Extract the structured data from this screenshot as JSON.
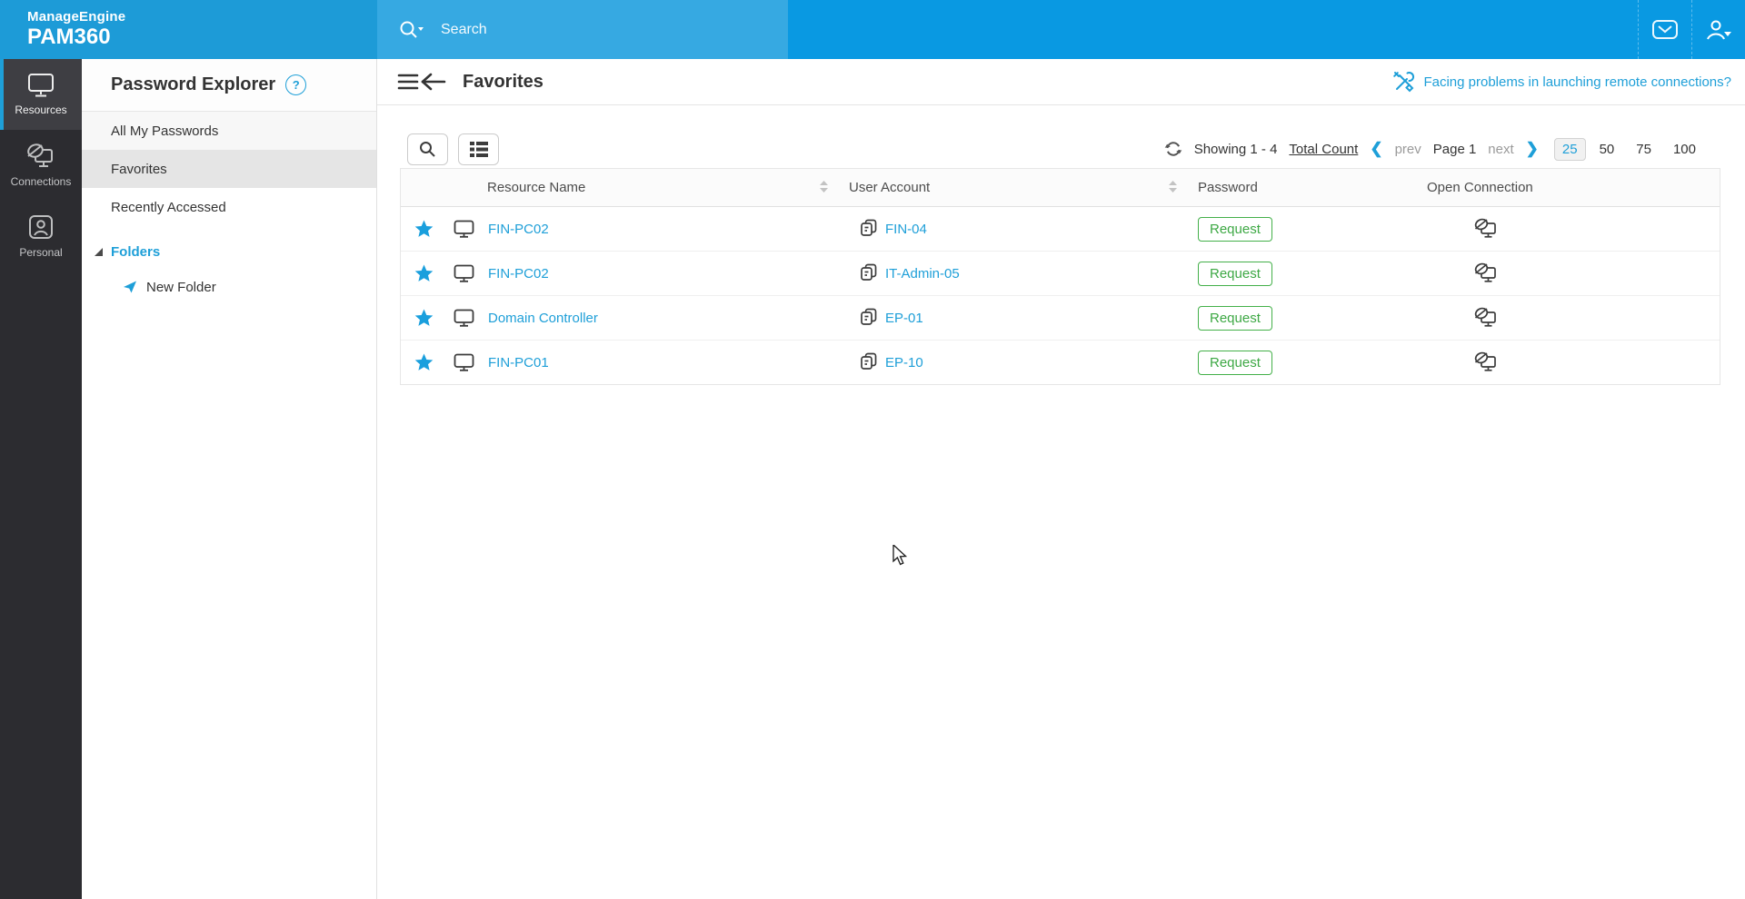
{
  "colors": {
    "brand-blue": "#1d9bd7",
    "search-blue": "#36a9e2",
    "header-blue": "#0999e2",
    "link-blue": "#1e9fd8",
    "green": "#3da844",
    "sidebar-dark": "#2c2c30"
  },
  "header": {
    "logo_line1": "ManageEngine",
    "logo_line2": "PAM360",
    "search_placeholder": "Search"
  },
  "sidebar": {
    "items": [
      {
        "label": "Resources"
      },
      {
        "label": "Connections"
      },
      {
        "label": "Personal"
      }
    ]
  },
  "explorer": {
    "title": "Password Explorer",
    "help": "?",
    "items": [
      "All My Passwords",
      "Favorites",
      "Recently Accessed"
    ],
    "folders_label": "Folders",
    "new_folder_label": "New Folder"
  },
  "main": {
    "title": "Favorites",
    "remote_link": "Facing problems in launching remote connections?",
    "pagination": {
      "showing": "Showing 1 - 4",
      "total_count_label": "Total Count",
      "prev_chevron": "❮",
      "prev": "prev",
      "page": "Page 1",
      "next": "next",
      "next_chevron": "❯",
      "page_sizes": [
        "25",
        "50",
        "75",
        "100"
      ],
      "active_size": "25"
    },
    "table": {
      "columns": [
        "Resource Name",
        "User Account",
        "Password",
        "Open Connection"
      ],
      "rows": [
        {
          "resource": "FIN-PC02",
          "account": "FIN-04",
          "password_action": "Request"
        },
        {
          "resource": "FIN-PC02",
          "account": "IT-Admin-05",
          "password_action": "Request"
        },
        {
          "resource": "Domain Controller",
          "account": "EP-01",
          "password_action": "Request"
        },
        {
          "resource": "FIN-PC01",
          "account": "EP-10",
          "password_action": "Request"
        }
      ]
    }
  }
}
